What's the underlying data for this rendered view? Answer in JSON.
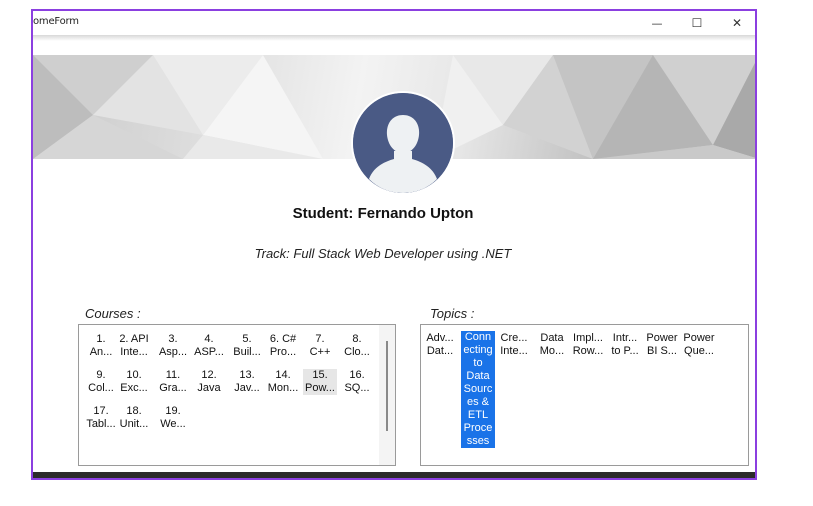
{
  "window": {
    "title": "omeForm",
    "minimize_glyph": "—",
    "maximize_glyph": "☐",
    "close_glyph": "✕"
  },
  "profile": {
    "student_text": "Student: Fernando Upton",
    "track_text": "Track: Full Stack Web Developer using .NET",
    "avatar_icon": "user-silhouette-icon"
  },
  "courses": {
    "label": "Courses :",
    "items": [
      {
        "num": "1.",
        "name": "An..."
      },
      {
        "num": "2. API",
        "name": "Inte..."
      },
      {
        "num": "3.",
        "name": "Asp..."
      },
      {
        "num": "4.",
        "name": "ASP..."
      },
      {
        "num": "5.",
        "name": "Buil..."
      },
      {
        "num": "6. C#",
        "name": "Pro..."
      },
      {
        "num": "7.",
        "name": "C++"
      },
      {
        "num": "8.",
        "name": "Clo..."
      },
      {
        "num": "9.",
        "name": "Col..."
      },
      {
        "num": "10.",
        "name": "Exc..."
      },
      {
        "num": "11.",
        "name": "Gra..."
      },
      {
        "num": "12.",
        "name": "Java"
      },
      {
        "num": "13.",
        "name": "Jav..."
      },
      {
        "num": "14.",
        "name": "Mon..."
      },
      {
        "num": "15.",
        "name": "Pow..."
      },
      {
        "num": "16.",
        "name": "SQ..."
      },
      {
        "num": "17.",
        "name": "Tabl..."
      },
      {
        "num": "18.",
        "name": "Unit..."
      },
      {
        "num": "19.",
        "name": "We..."
      }
    ]
  },
  "topics": {
    "label": "Topics :",
    "items": [
      {
        "lines": [
          "Adv...",
          "Dat..."
        ]
      },
      {
        "lines": [
          "Conn",
          "ecting",
          "to",
          "Data",
          "Sourc",
          "es &",
          "ETL",
          "Proce",
          "sses"
        ]
      },
      {
        "lines": [
          "Cre...",
          "Inte..."
        ]
      },
      {
        "lines": [
          "Data",
          "Mo..."
        ]
      },
      {
        "lines": [
          "Impl...",
          "Row..."
        ]
      },
      {
        "lines": [
          "Intr...",
          "to P..."
        ]
      },
      {
        "lines": [
          "Power",
          "BI S..."
        ]
      },
      {
        "lines": [
          "Power",
          "Que..."
        ]
      }
    ]
  },
  "colors": {
    "window_border": "#8b3fe0",
    "selection_blue": "#1a73e8",
    "avatar_bg": "#4a5a85"
  }
}
